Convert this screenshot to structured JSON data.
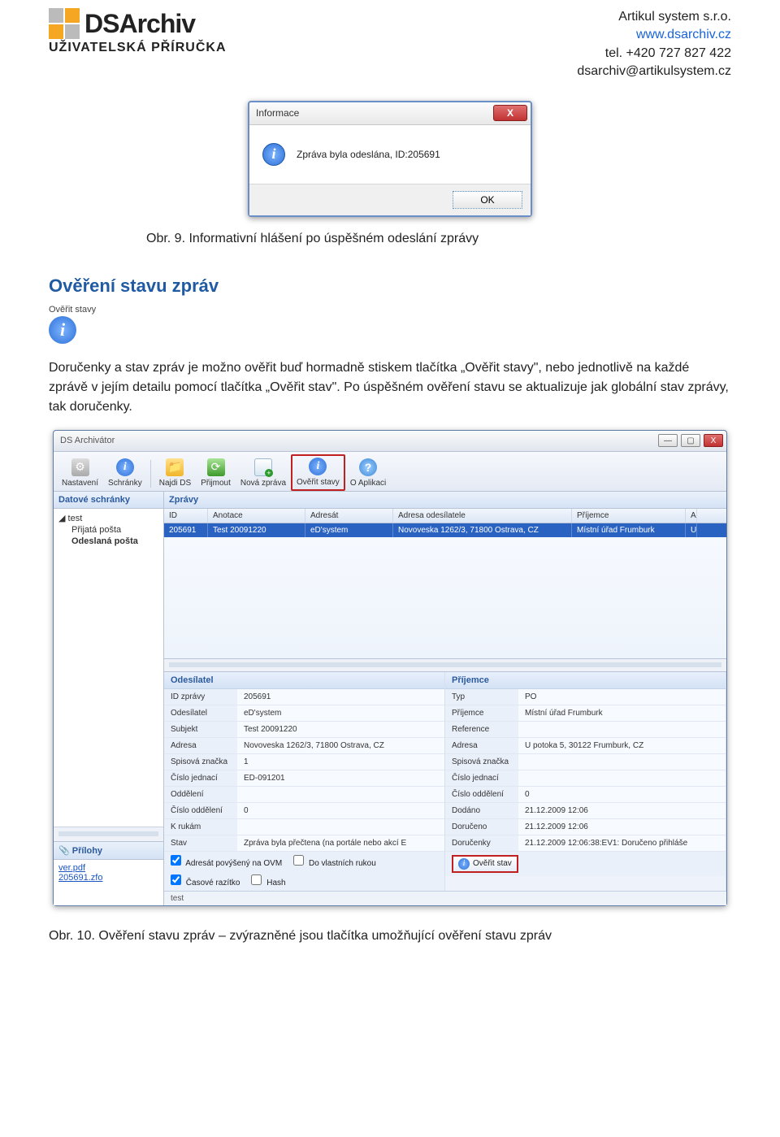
{
  "header": {
    "logo_text": "DSArchiv",
    "subtitle": "UŽIVATELSKÁ PŘÍRUČKA",
    "company": {
      "name": "Artikul system s.r.o.",
      "url": "www.dsarchiv.cz",
      "tel": "tel. +420 727 827 422",
      "email": "dsarchiv@artikulsystem.cz"
    }
  },
  "dialog1": {
    "title": "Informace",
    "close_label": "X",
    "message": "Zpráva byla odeslána, ID:205691",
    "ok_label": "OK"
  },
  "caption1": "Obr. 9. Informativní hlášení po úspěšném odeslání zprávy",
  "section_h": "Ověření stavu zpráv",
  "verify_icon_label": "Ověřit stavy",
  "body_p": "Doručenky a stav zpráv je možno ověřit buď hormadně stiskem tlačítka „Ověřit stavy\", nebo jednotlivě na každé zprávě v jejím detailu pomocí tlačítka „Ověřit stav\". Po úspěšném ověření stavu se aktualizuje jak globální stav zprávy, tak doručenky.",
  "app": {
    "title": "DS Archivátor",
    "toolbar": {
      "nastaveni": "Nastavení",
      "schranky": "Schránky",
      "najdi": "Najdi DS",
      "prijmout": "Přijmout",
      "nova": "Nová zpráva",
      "overit": "Ověřit stavy",
      "about": "O Aplikaci"
    },
    "datove_h": "Datové schránky",
    "tree": {
      "root": "test",
      "inbox": "Přijatá pošta",
      "sent": "Odeslaná pošta"
    },
    "scroll_handle": "⟨  ⟩",
    "prilohy_h": "Přílohy",
    "prilohy_files": [
      "ver.pdf",
      "205691.zfo"
    ],
    "zpravy_h": "Zprávy",
    "cols": {
      "id": "ID",
      "anotace": "Anotace",
      "adresat": "Adresát",
      "adresa_od": "Adresa odesílatele",
      "prijemce": "Příjemce",
      "a": "A"
    },
    "row": {
      "id": "205691",
      "anotace": "Test 20091220",
      "adresat": "eD'system",
      "adresa_od": "Novoveska 1262/3, 71800 Ostrava, CZ",
      "prijemce": "Místní úřad Frumburk",
      "a": "U"
    },
    "sender_h": "Odesílatel",
    "receiver_h": "Příjemce",
    "sender": {
      "id_lbl": "ID zprávy",
      "id": "205691",
      "od_lbl": "Odesílatel",
      "od": "eD'system",
      "subj_lbl": "Subjekt",
      "subj": "Test 20091220",
      "adresa_lbl": "Adresa",
      "adresa": "Novoveska 1262/3, 71800 Ostrava, CZ",
      "spis_lbl": "Spisová značka",
      "spis": "1",
      "cj_lbl": "Číslo jednací",
      "cj": "ED-091201",
      "odd_lbl": "Oddělení",
      "odd": "",
      "co_lbl": "Číslo oddělení",
      "co": "0",
      "ruk_lbl": "K rukám",
      "ruk": "",
      "stav_lbl": "Stav",
      "stav": "Zpráva byla přečtena (na portále nebo akcí E",
      "chk1": "Adresát povýšený na OVM",
      "chk2": "Do vlastních rukou",
      "chk3": "Časové razítko",
      "chk4": "Hash"
    },
    "receiver": {
      "typ_lbl": "Typ",
      "typ": "PO",
      "pr_lbl": "Příjemce",
      "pr": "Místní úřad Frumburk",
      "ref_lbl": "Reference",
      "ref": "",
      "adresa_lbl": "Adresa",
      "adresa": "U potoka 5, 30122 Frumburk, CZ",
      "spis_lbl": "Spisová značka",
      "spis": "",
      "cj_lbl": "Číslo jednací",
      "cj": "",
      "co_lbl": "Číslo oddělení",
      "co": "0",
      "dodano_lbl": "Dodáno",
      "dodano": "21.12.2009 12:06",
      "doruceno_lbl": "Doručeno",
      "doruceno": "21.12.2009 12:06",
      "dorucenky_lbl": "Doručenky",
      "dorucenky": "21.12.2009 12:06:38:EV1: Doručeno přihláše",
      "btn": "Ověřit stav"
    },
    "status": "test"
  },
  "caption2": "Obr. 10. Ověření stavu zpráv – zvýrazněné jsou tlačítka umožňující ověření stavu zpráv"
}
